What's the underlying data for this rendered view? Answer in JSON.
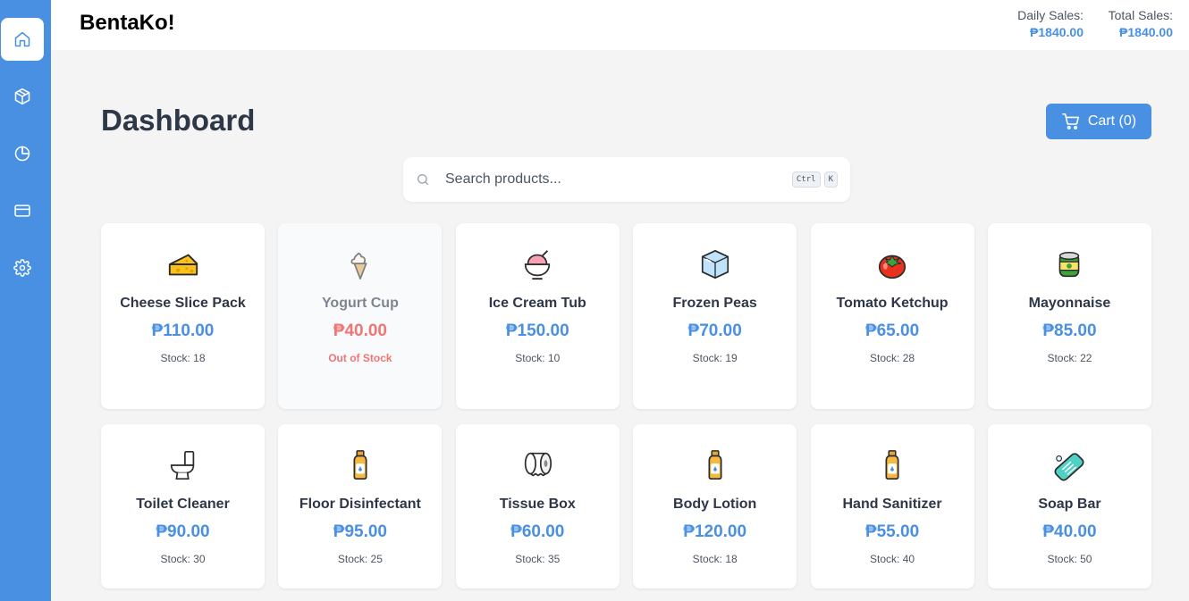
{
  "app": {
    "brand": "BentaKo!"
  },
  "header": {
    "daily_sales_label": "Daily Sales:",
    "daily_sales_value": "₱1840.00",
    "total_sales_label": "Total Sales:",
    "total_sales_value": "₱1840.00"
  },
  "sidebar": {
    "items": [
      {
        "icon": "home-icon",
        "active": true
      },
      {
        "icon": "box-icon",
        "active": false
      },
      {
        "icon": "pie-chart-icon",
        "active": false
      },
      {
        "icon": "credit-card-icon",
        "active": false
      },
      {
        "icon": "gear-icon",
        "active": false
      }
    ]
  },
  "page": {
    "title": "Dashboard"
  },
  "cart": {
    "label": "Cart (0)"
  },
  "search": {
    "placeholder": "Search products...",
    "kbd_ctrl": "Ctrl",
    "kbd_k": "K"
  },
  "products": [
    {
      "name": "Cheese Slice Pack",
      "price": "₱110.00",
      "stock": "Stock: 18",
      "icon": "cheese-icon"
    },
    {
      "name": "Yogurt Cup",
      "price": "₱40.00",
      "stock": "Out of Stock",
      "icon": "soft-ice-cream-icon"
    },
    {
      "name": "Ice Cream Tub",
      "price": "₱150.00",
      "stock": "Stock: 10",
      "icon": "shaved-ice-icon"
    },
    {
      "name": "Frozen Peas",
      "price": "₱70.00",
      "stock": "Stock: 19",
      "icon": "ice-cube-icon"
    },
    {
      "name": "Tomato Ketchup",
      "price": "₱65.00",
      "stock": "Stock: 28",
      "icon": "tomato-icon"
    },
    {
      "name": "Mayonnaise",
      "price": "₱85.00",
      "stock": "Stock: 22",
      "icon": "canned-food-icon"
    },
    {
      "name": "Toilet Cleaner",
      "price": "₱90.00",
      "stock": "Stock: 30",
      "icon": "toilet-icon"
    },
    {
      "name": "Floor Disinfectant",
      "price": "₱95.00",
      "stock": "Stock: 25",
      "icon": "lotion-bottle-icon"
    },
    {
      "name": "Tissue Box",
      "price": "₱60.00",
      "stock": "Stock: 35",
      "icon": "toilet-paper-roll-icon"
    },
    {
      "name": "Body Lotion",
      "price": "₱120.00",
      "stock": "Stock: 18",
      "icon": "lotion-bottle-icon"
    },
    {
      "name": "Hand Sanitizer",
      "price": "₱55.00",
      "stock": "Stock: 40",
      "icon": "lotion-bottle-icon"
    },
    {
      "name": "Soap Bar",
      "price": "₱40.00",
      "stock": "Stock: 50",
      "icon": "soap-icon"
    }
  ],
  "colors": {
    "accent": "#4a90e2",
    "out_of_stock": "#f07575",
    "background": "#f4f4f5"
  }
}
